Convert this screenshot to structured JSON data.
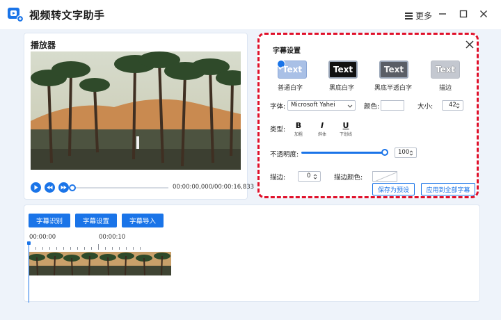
{
  "app": {
    "title": "视频转文字助手"
  },
  "titlebar": {
    "more_label": "更多"
  },
  "player": {
    "panel_title": "播放器",
    "time_display": "00:00:00,000/00:00:16,833",
    "progress": 0.0
  },
  "settings": {
    "title": "字幕设置",
    "presets": [
      {
        "sample": "Text",
        "label": "普通白字",
        "selected": true
      },
      {
        "sample": "Text",
        "label": "黑底白字",
        "selected": false
      },
      {
        "sample": "Text",
        "label": "黑底半透白字",
        "selected": false
      },
      {
        "sample": "Text",
        "label": "描边",
        "selected": false
      }
    ],
    "font_label": "字体:",
    "font_value": "Microsoft Yahei",
    "color_label": "颜色:",
    "size_label": "大小:",
    "size_value": "42",
    "type_label": "类型:",
    "type_buttons": [
      {
        "glyph": "B",
        "label": "加粗"
      },
      {
        "glyph": "I",
        "label": "斜体"
      },
      {
        "glyph": "U",
        "label": "下划线"
      }
    ],
    "opacity_label": "不透明度:",
    "opacity_value": "100",
    "stroke_label": "描边:",
    "stroke_value": "0",
    "stroke_color_label": "描边颜色:",
    "save_preset_label": "保存为预设",
    "apply_all_label": "应用到全部字幕"
  },
  "timeline": {
    "buttons": [
      "字幕识别",
      "字幕设置",
      "字幕导入"
    ],
    "time_start": "00:00:00",
    "time_mark": "00:00:10"
  },
  "colors": {
    "accent": "#1a74e8",
    "highlight_border": "#e0102a",
    "background": "#eef3fa"
  }
}
